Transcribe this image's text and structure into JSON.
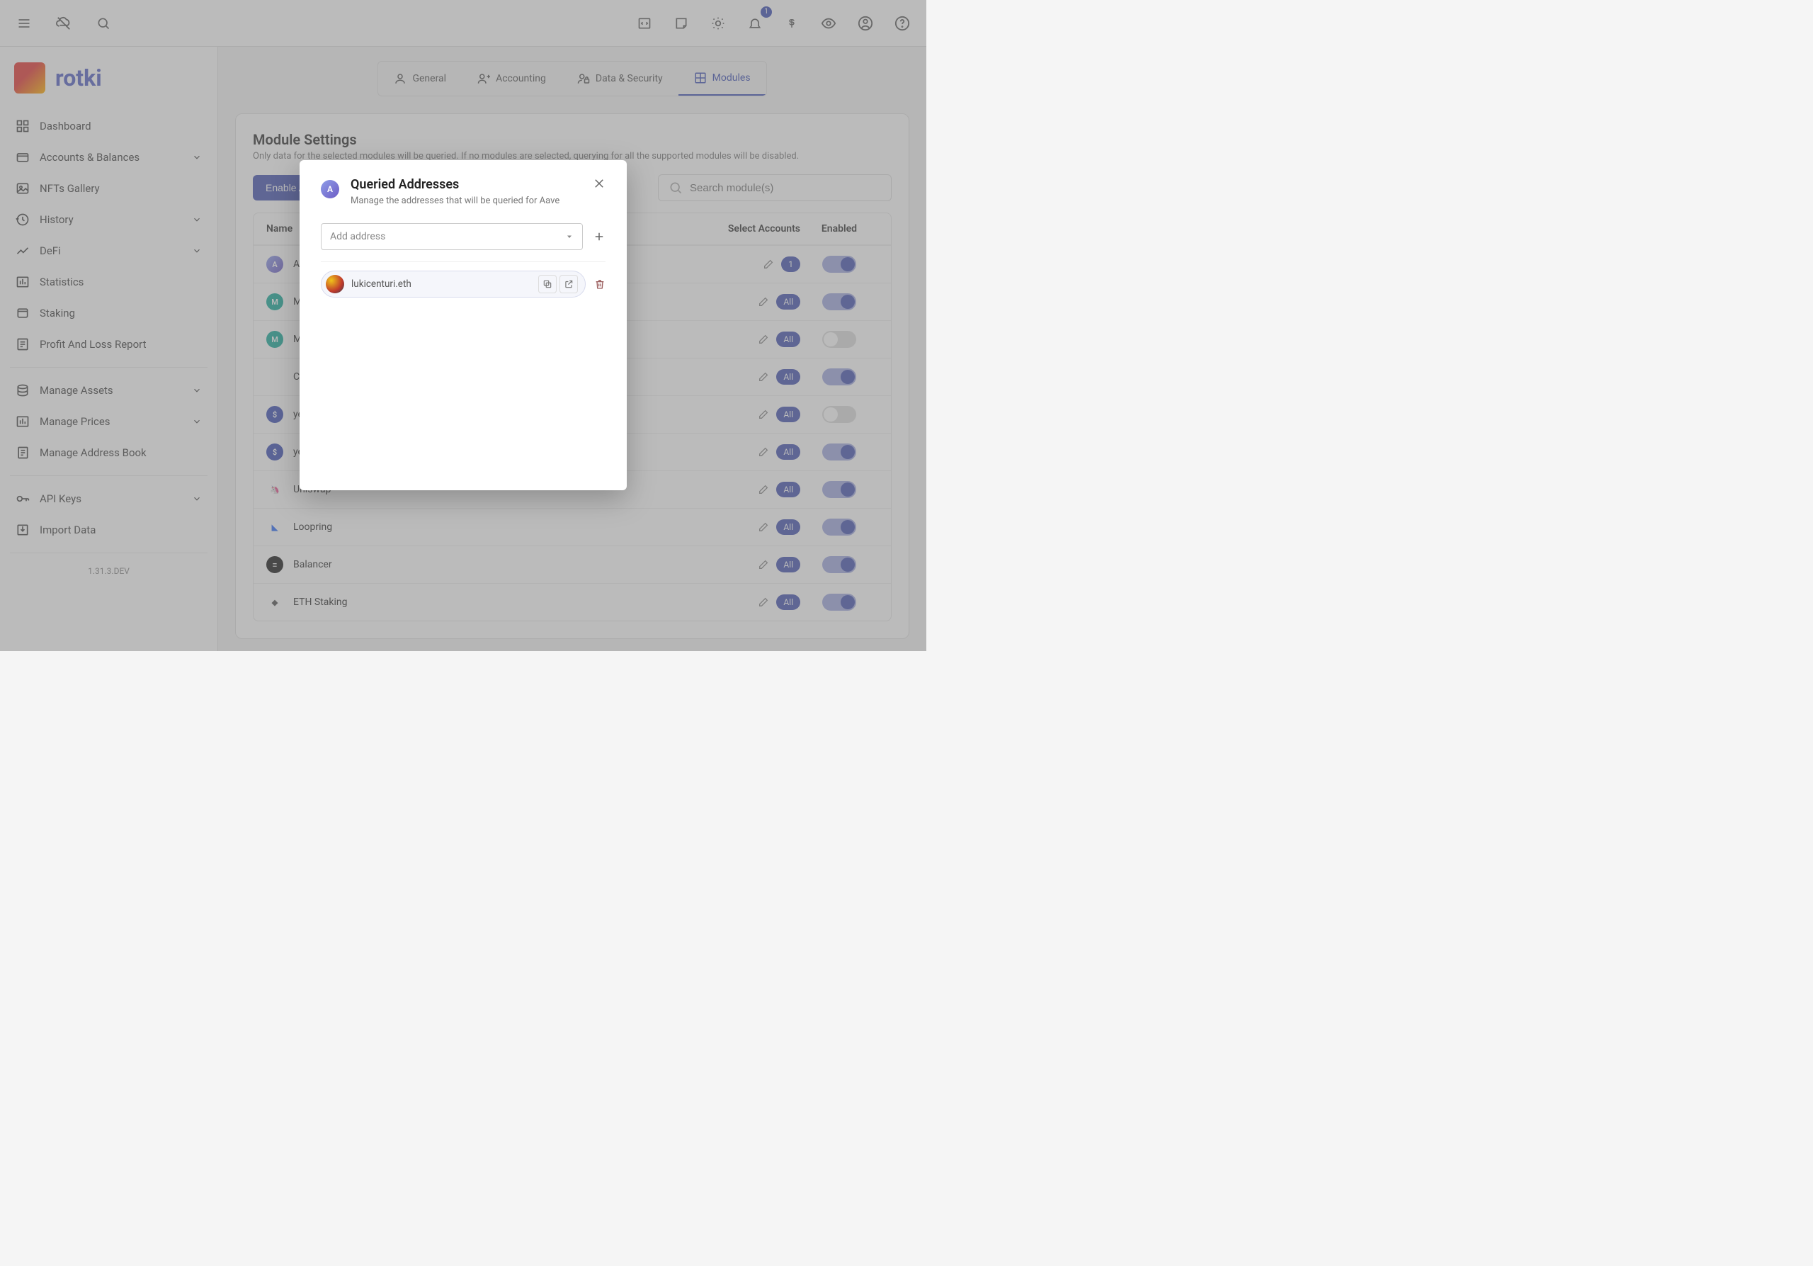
{
  "header": {
    "notifications_count": "1"
  },
  "app": {
    "name": "rotki",
    "version": "1.31.3.DEV"
  },
  "sidebar": {
    "items": [
      {
        "label": "Dashboard"
      },
      {
        "label": "Accounts & Balances",
        "expandable": true
      },
      {
        "label": "NFTs Gallery"
      },
      {
        "label": "History",
        "expandable": true
      },
      {
        "label": "DeFi",
        "expandable": true
      },
      {
        "label": "Statistics"
      },
      {
        "label": "Staking"
      },
      {
        "label": "Profit And Loss Report"
      }
    ],
    "items2": [
      {
        "label": "Manage Assets",
        "expandable": true
      },
      {
        "label": "Manage Prices",
        "expandable": true
      },
      {
        "label": "Manage Address Book"
      }
    ],
    "items3": [
      {
        "label": "API Keys",
        "expandable": true
      },
      {
        "label": "Import Data"
      }
    ]
  },
  "tabs": [
    {
      "label": "General"
    },
    {
      "label": "Accounting"
    },
    {
      "label": "Data & Security"
    },
    {
      "label": "Modules",
      "active": true
    }
  ],
  "page": {
    "title": "Module Settings",
    "subtitle": "Only data for the selected modules will be queried. If no modules are selected, querying for all the supported modules will be disabled.",
    "enable_all": "Enable All",
    "search_placeholder": "Search module(s)"
  },
  "table": {
    "headers": {
      "name": "Name",
      "accounts": "Select Accounts",
      "enabled": "Enabled"
    },
    "rows": [
      {
        "name": "Aav",
        "accounts_pill": "1",
        "enabled": true,
        "icon_bg": "linear-gradient(135deg,#8e9de8,#6d5cc5)",
        "icon_text": "A"
      },
      {
        "name": "Mak",
        "accounts_pill": "All",
        "enabled": true,
        "icon_bg": "#1aab9b",
        "icon_text": "M"
      },
      {
        "name": "Mak",
        "accounts_pill": "All",
        "enabled": false,
        "icon_bg": "#1aab9b",
        "icon_text": "M"
      },
      {
        "name": "Com",
        "accounts_pill": "All",
        "enabled": true,
        "icon_bg": "#ffffff",
        "icon_text": "",
        "icon_fg": "#1aab9b"
      },
      {
        "name": "yea",
        "accounts_pill": "All",
        "enabled": false,
        "icon_bg": "#3f51b5",
        "icon_text": "$"
      },
      {
        "name": "yea",
        "accounts_pill": "All",
        "enabled": true,
        "icon_bg": "#3f51b5",
        "icon_text": "$"
      },
      {
        "name": "Uniswap",
        "accounts_pill": "All",
        "enabled": true,
        "icon_bg": "#ffffff",
        "icon_text": "🦄"
      },
      {
        "name": "Loopring",
        "accounts_pill": "All",
        "enabled": true,
        "icon_bg": "#ffffff",
        "icon_text": "◣",
        "icon_fg": "#2e6cf6"
      },
      {
        "name": "Balancer",
        "accounts_pill": "All",
        "enabled": true,
        "icon_bg": "#1a1a1a",
        "icon_text": "≡"
      },
      {
        "name": "ETH Staking",
        "accounts_pill": "All",
        "enabled": true,
        "icon_bg": "#ffffff",
        "icon_text": "◆",
        "icon_fg": "#555"
      }
    ]
  },
  "modal": {
    "title": "Queried Addresses",
    "subtitle": "Manage the addresses that will be queried for Aave",
    "add_placeholder": "Add address",
    "address": "lukicenturi.eth"
  }
}
